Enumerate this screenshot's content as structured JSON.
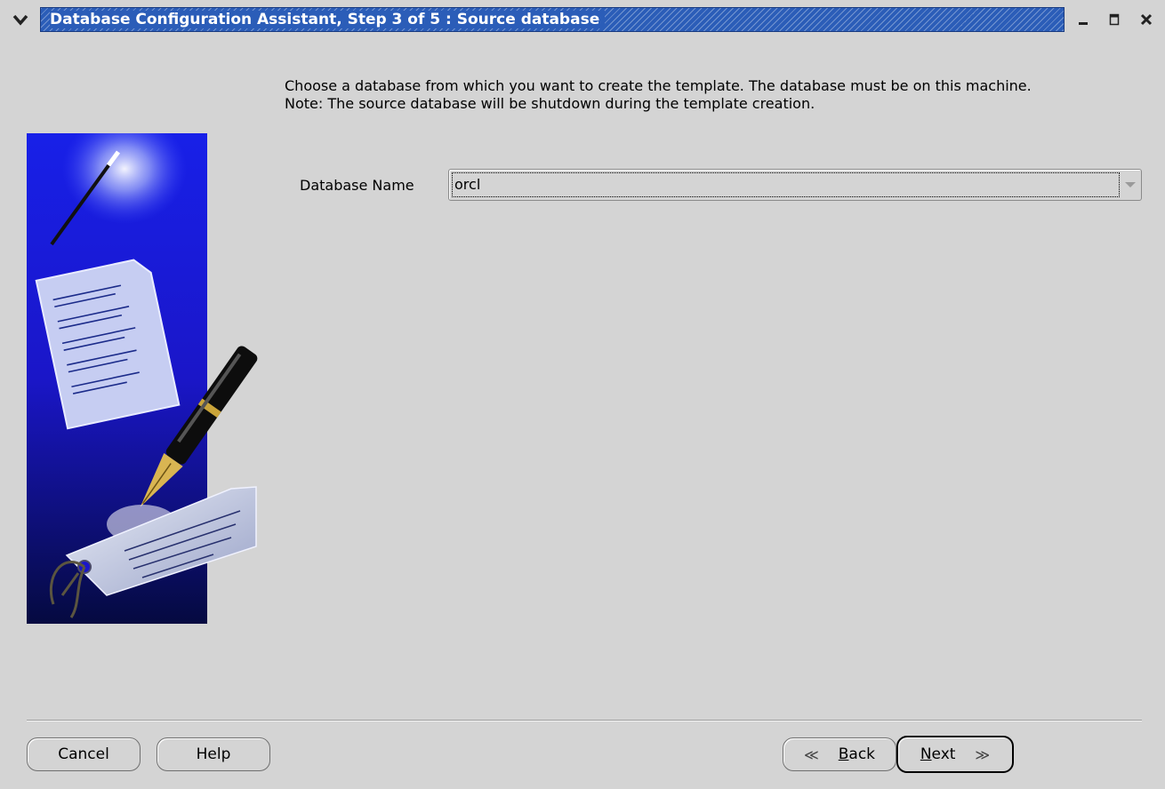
{
  "window": {
    "title": "Database Configuration Assistant, Step 3 of 5 : Source database",
    "menu_icon": "chevron-down-icon",
    "controls": [
      "minimize-icon",
      "maximize-icon",
      "close-icon"
    ]
  },
  "instructions": {
    "line1": "Choose a database from which you want to create the template. The database must be on this machine.",
    "line2": "Note: The source database will be shutdown during the template creation."
  },
  "form": {
    "database_name_label": "Database Name",
    "database_name_value": "orcl"
  },
  "buttons": {
    "cancel": "Cancel",
    "help": "Help",
    "back_mnemonic": "B",
    "back_rest": "ack",
    "next_mnemonic": "N",
    "next_rest": "ext"
  },
  "colors": {
    "title_bar": "#2b5db8",
    "window_bg": "#d4d4d4",
    "art_background": "#1a1ae0"
  }
}
